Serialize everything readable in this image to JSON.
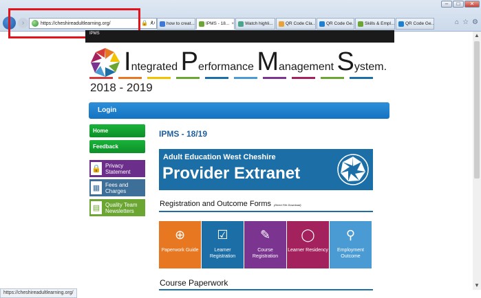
{
  "browser": {
    "address_url": "https://cheshireadultlearning.org/",
    "status_url": "https://cheshireadultlearning.org/",
    "tabs": [
      {
        "label": "how to creat...",
        "icon_color": "#3b78d8",
        "active": false
      },
      {
        "label": "IPMS - 18...",
        "icon_color": "#6aa631",
        "active": true
      },
      {
        "label": "Watch highli...",
        "icon_color": "#4aa58a",
        "active": false
      },
      {
        "label": "QR Code Cla...",
        "icon_color": "#e8a23a",
        "active": false
      },
      {
        "label": "QR Code Ge...",
        "icon_color": "#1f7fd0",
        "active": false
      },
      {
        "label": "Skills & Empl...",
        "icon_color": "#6aa631",
        "active": false
      },
      {
        "label": "QR Code Ge...",
        "icon_color": "#1f7fd0",
        "active": false
      }
    ],
    "right_icons": [
      "home-icon",
      "star-icon",
      "gear-icon"
    ]
  },
  "page": {
    "top_bar_label": "IPMS",
    "brand": {
      "I": "I",
      "ntegrated": "ntegrated ",
      "P": "P",
      "erformance": "erformance ",
      "M": "M",
      "anagement": "anagement ",
      "S": "S",
      "ystem": "ystem."
    },
    "year": "2018 - 2019",
    "login": "Login",
    "sidebar": {
      "home": "Home",
      "feedback": "Feedback",
      "privacy": "Privacy Statement",
      "fees": "Fees and Charges",
      "quality": "Quality Team Newsletters"
    },
    "content_title": "IPMS - 18/19",
    "banner": {
      "subtitle": "Adult Education West Cheshire",
      "title": "Provider Extranet"
    },
    "registration": {
      "title": "Registration and Outcome Forms",
      "note": "(Direct File Download)"
    },
    "tiles": [
      {
        "label": "Paperwork Guide",
        "color": "#e87722",
        "icon": "globe-cursor-icon"
      },
      {
        "label": "Learner Registration",
        "color": "#1c6fa6",
        "icon": "clipboard-check-icon"
      },
      {
        "label": "Course Registration",
        "color": "#7b3591",
        "icon": "document-pen-icon"
      },
      {
        "label": "Learner Residency",
        "color": "#a3225d",
        "icon": "speech-bubble-icon"
      },
      {
        "label": "Employment Outcome",
        "color": "#4a9bd4",
        "icon": "person-add-icon"
      }
    ],
    "course_paperwork": "Course Paperwork"
  },
  "colors": {
    "accent_blue": "#1c6fa6",
    "highlight_red": "#e2131b",
    "green": "#19b33a"
  }
}
